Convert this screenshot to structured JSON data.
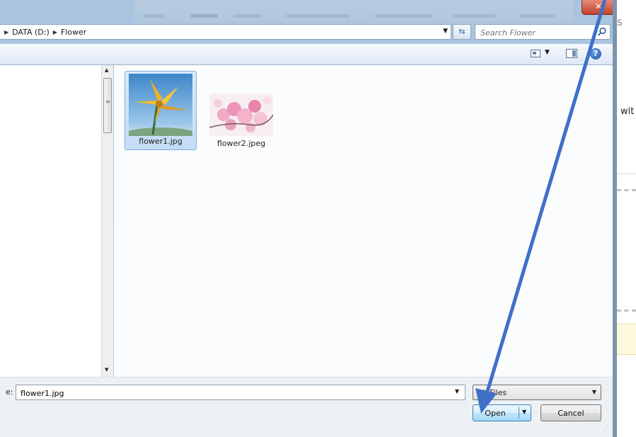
{
  "background_page": {
    "side_text": "wit",
    "side_letter": "s"
  },
  "window": {
    "close_label": "✕"
  },
  "address_bar": {
    "crumbs": [
      "DATA (D:)",
      "Flower"
    ]
  },
  "search": {
    "placeholder": "Search Flower"
  },
  "toolbar": {
    "help_label": "?"
  },
  "files": [
    {
      "name": "flower1.jpg",
      "selected": true
    },
    {
      "name": "flower2.jpeg",
      "selected": false
    }
  ],
  "footer": {
    "file_name_label": "e:",
    "file_name_value": "flower1.jpg",
    "filter_value": "All Files",
    "open_label": "Open",
    "cancel_label": "Cancel"
  },
  "colors": {
    "annotation_arrow": "#3f6fc8",
    "selection": "#c3dcf6"
  }
}
